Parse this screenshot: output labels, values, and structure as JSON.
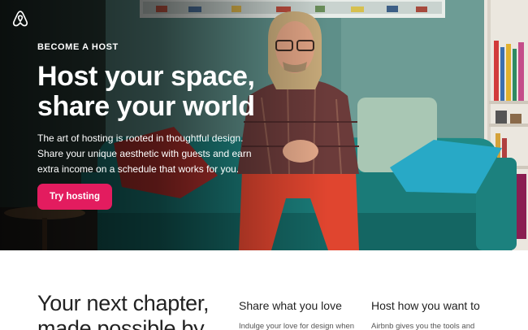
{
  "hero": {
    "eyebrow": "BECOME A HOST",
    "title_line1": "Host your space,",
    "title_line2": "share your world",
    "desc_line1": "The art of hosting is rooted in thoughtful design.",
    "desc_line2": "Share your unique aesthetic with guests and earn",
    "desc_line3": "extra income on a schedule that works for you.",
    "cta_label": "Try hosting",
    "brand_color": "#e31c5f",
    "logo_icon": "airbnb-logo-icon"
  },
  "section": {
    "heading_line1": "Your next chapter,",
    "heading_line2": "made possible by",
    "columns": [
      {
        "title": "Share what you love",
        "text": "Indulge your love for design when"
      },
      {
        "title": "Host how you want to",
        "text": "Airbnb gives you the tools and"
      }
    ]
  }
}
